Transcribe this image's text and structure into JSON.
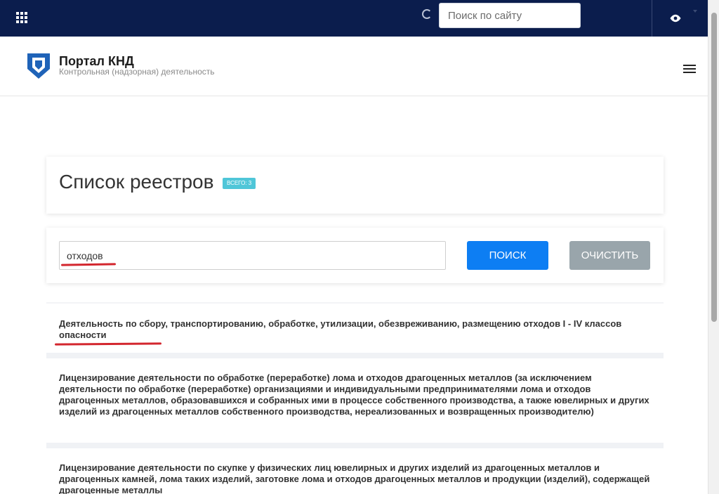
{
  "topbar": {
    "search_placeholder": "Поиск по сайту"
  },
  "header": {
    "title": "Портал КНД",
    "subtitle": "Контрольная (надзорная) деятельность"
  },
  "main": {
    "title": "Список реестров",
    "count_badge": "всего: 3"
  },
  "search": {
    "query": "отходов",
    "search_label": "Поиск",
    "clear_label": "Очистить"
  },
  "results": [
    {
      "text": "Деятельность по сбору, транспортированию, обработке, утилизации, обезвреживанию, размещению отходов I - IV классов опасности"
    },
    {
      "text": "Лицензирование деятельности по обработке (переработке) лома и отходов драгоценных металлов (за исключением деятельности по обработке (переработке) организациями и индивидуальными предпринимателями лома и отходов драгоценных металлов, образовавшихся и собранных ими в процессе собственного производства, а также ювелирных и других изделий из драгоценных металлов собственного производства, нереализованных и возвращенных производителю)"
    },
    {
      "text": "Лицензирование деятельности по скупке у физических лиц ювелирных и других изделий из драгоценных металлов и драгоценных камней, лома таких изделий, заготовке лома и отходов драгоценных металлов и продукции (изделий), содержащей драгоценные металлы"
    }
  ],
  "colors": {
    "topbar": "#0b1d4d",
    "primary_button": "#0d7ef3",
    "secondary_button": "#99a5ab",
    "badge": "#4fc6d8",
    "annotation": "#d3262e"
  },
  "icons": {
    "apps": "apps-grid-icon",
    "loader": "loader-icon",
    "accessibility": "eye-icon",
    "logo": "shield-logo-icon",
    "menu": "hamburger-menu-icon"
  }
}
